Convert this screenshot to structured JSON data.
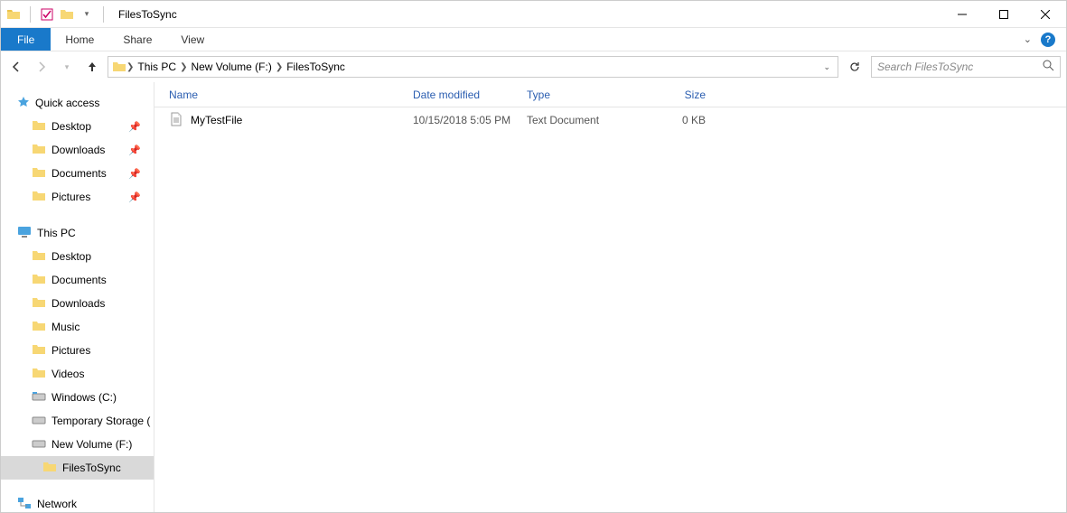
{
  "window": {
    "title": "FilesToSync"
  },
  "ribbon": {
    "file": "File",
    "tabs": [
      "Home",
      "Share",
      "View"
    ]
  },
  "breadcrumb": [
    "This PC",
    "New Volume (F:)",
    "FilesToSync"
  ],
  "search": {
    "placeholder": "Search FilesToSync"
  },
  "tree": {
    "quick_access": {
      "label": "Quick access",
      "items": [
        "Desktop",
        "Downloads",
        "Documents",
        "Pictures"
      ]
    },
    "this_pc": {
      "label": "This PC",
      "items": [
        "Desktop",
        "Documents",
        "Downloads",
        "Music",
        "Pictures",
        "Videos",
        "Windows (C:)",
        "Temporary Storage (",
        "New Volume (F:)"
      ],
      "subfolder": "FilesToSync"
    },
    "network": {
      "label": "Network"
    }
  },
  "columns": {
    "name": "Name",
    "date": "Date modified",
    "type": "Type",
    "size": "Size"
  },
  "files": [
    {
      "name": "MyTestFile",
      "date": "10/15/2018 5:05 PM",
      "type": "Text Document",
      "size": "0 KB"
    }
  ]
}
